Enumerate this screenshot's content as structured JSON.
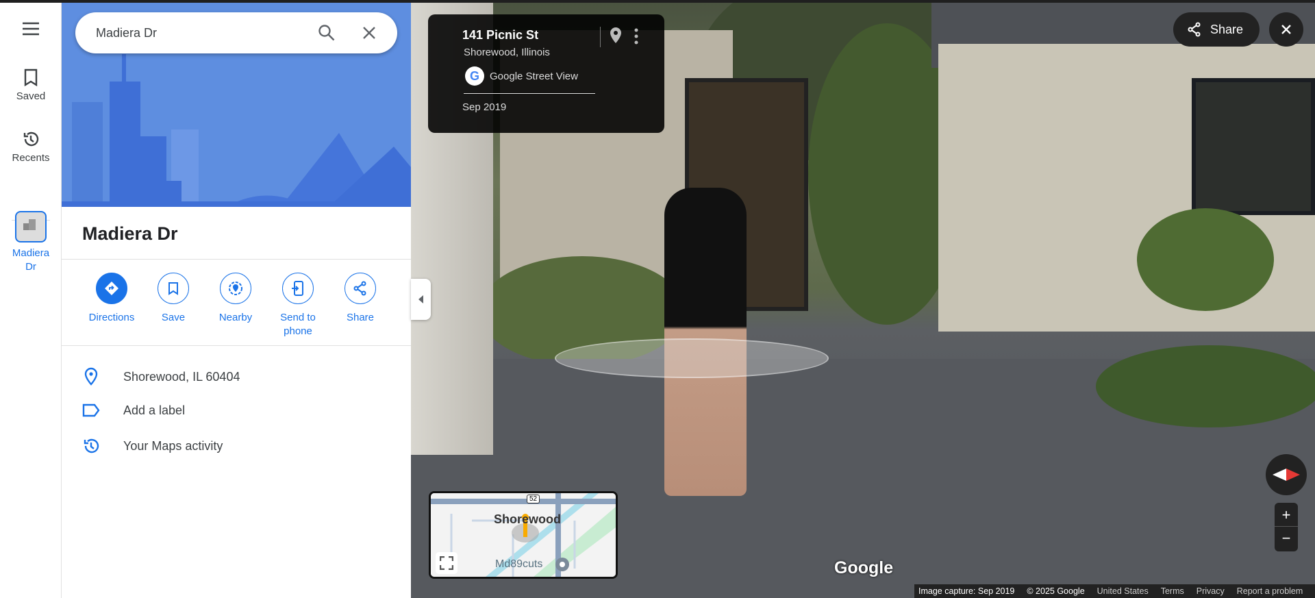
{
  "rail": {
    "saved": "Saved",
    "recents": "Recents",
    "recent_place": "Madiera Dr"
  },
  "search": {
    "value": "Madiera Dr"
  },
  "place": {
    "title": "Madiera Dr"
  },
  "actions": [
    {
      "label": "Directions"
    },
    {
      "label": "Save"
    },
    {
      "label": "Nearby"
    },
    {
      "label": "Send to phone"
    },
    {
      "label": "Share"
    }
  ],
  "details": {
    "address": "Shorewood, IL 60404",
    "label": "Add a label",
    "activity": "Your Maps activity"
  },
  "streetview": {
    "address": "141 Picnic St",
    "locality": "Shorewood, Illinois",
    "source": "Google Street View",
    "date": "Sep 2019",
    "share": "Share",
    "logo": "Google"
  },
  "minimap": {
    "town": "Shorewood",
    "route": "52",
    "poi": "Md89cuts"
  },
  "footer": {
    "capture": "Image capture: Sep 2019",
    "copyright": "© 2025 Google",
    "country": "United States",
    "terms": "Terms",
    "privacy": "Privacy",
    "report": "Report a problem"
  },
  "colors": {
    "accent": "#1a73e8",
    "hero": "#5e8ee0"
  }
}
